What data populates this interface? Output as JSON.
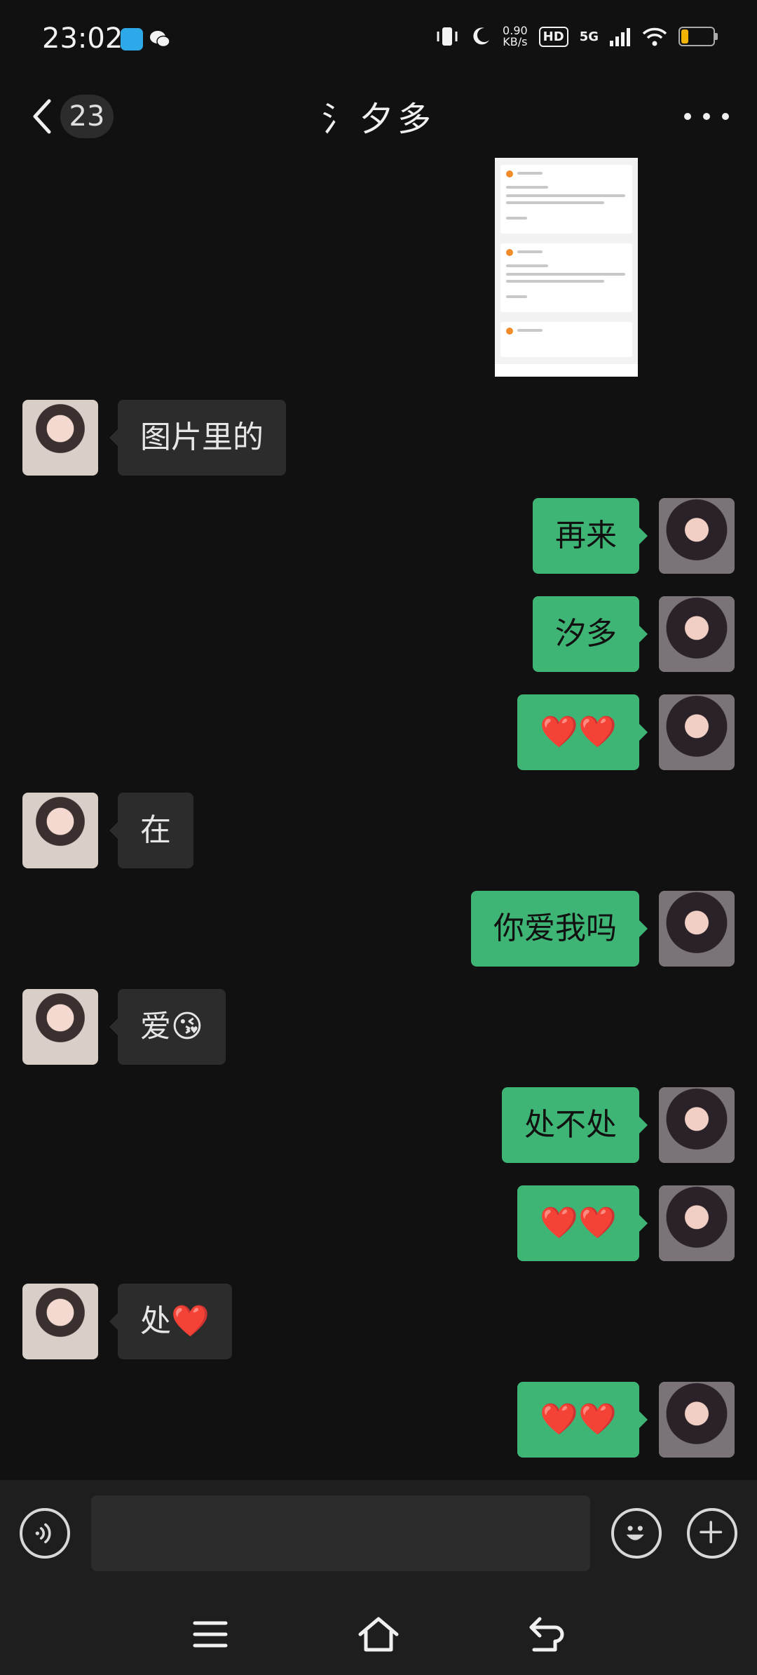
{
  "status_bar": {
    "time": "23:02",
    "netspeed_value": "0.90",
    "netspeed_unit": "KB/s",
    "hd_label": "HD",
    "network_label": "5G",
    "colors": {
      "app_icon_blue": "#2da8e8",
      "battery_yellow": "#f0b400"
    }
  },
  "header": {
    "back_icon": "chevron-left-icon",
    "unread_count": "23",
    "title": "氵夕多",
    "more_icon": "ellipsis-icon"
  },
  "messages": [
    {
      "side": "right",
      "type": "image",
      "content": "screenshot-thumbnail"
    },
    {
      "side": "left",
      "type": "text",
      "text": "图片里的"
    },
    {
      "side": "right",
      "type": "text",
      "text": "再来"
    },
    {
      "side": "right",
      "type": "text",
      "text": "汐多"
    },
    {
      "side": "right",
      "type": "text",
      "text": "❤️❤️"
    },
    {
      "side": "left",
      "type": "text",
      "text": "在"
    },
    {
      "side": "right",
      "type": "text",
      "text": "你爱我吗"
    },
    {
      "side": "left",
      "type": "text",
      "text": "爱😘"
    },
    {
      "side": "right",
      "type": "text",
      "text": "处不处"
    },
    {
      "side": "right",
      "type": "text",
      "text": "❤️❤️"
    },
    {
      "side": "left",
      "type": "text",
      "text": "处❤️"
    },
    {
      "side": "right",
      "type": "text",
      "text": "❤️❤️"
    }
  ],
  "input_bar": {
    "voice_icon": "voice-icon",
    "input_value": "",
    "emoji_icon": "smiley-icon",
    "add_icon": "plus-circle-icon"
  },
  "system_nav": {
    "menu_icon": "menu-icon",
    "home_icon": "home-icon",
    "back_icon": "back-icon"
  },
  "colors": {
    "background": "#111111",
    "bubble_sent": "#3eb575",
    "bubble_received": "#2c2c2c",
    "input_bar": "#1e1e1e"
  }
}
